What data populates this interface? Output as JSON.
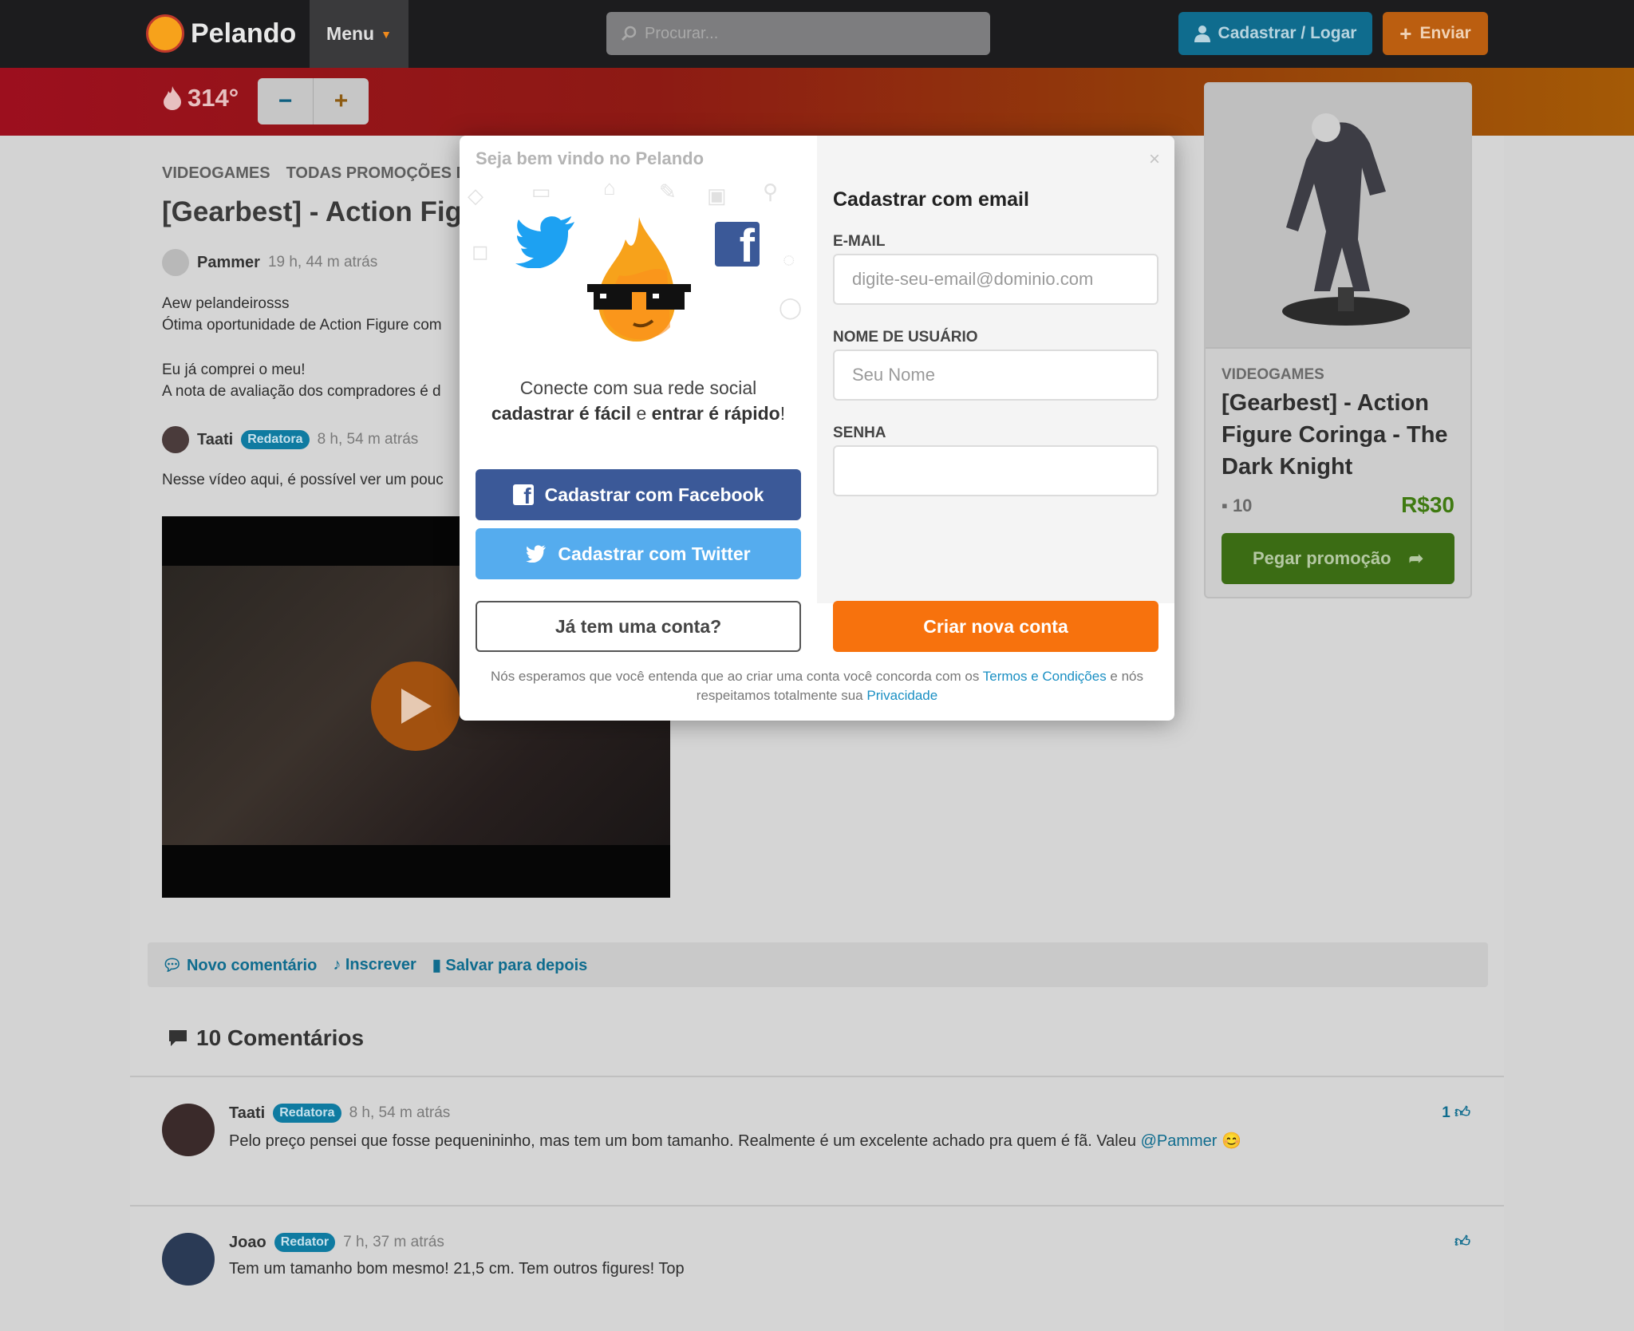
{
  "header": {
    "logo_text": "Pelando",
    "menu_label": "Menu",
    "search_placeholder": "Procurar...",
    "login_label": "Cadastrar / Logar",
    "send_label": "Enviar"
  },
  "heat": {
    "temperature": "314°",
    "minus": "−",
    "plus": "+"
  },
  "deal": {
    "crumbs": [
      "VIDEOGAMES",
      "TODAS PROMOÇÕES D"
    ],
    "title": "[Gearbest] - Action Figu",
    "author": "Pammer",
    "time": "19 h, 44 m atrás",
    "desc1": "Aew pelandeirosss",
    "desc2": "Ótima oportunidade de Action Figure com",
    "desc3": "Eu já comprei o meu!",
    "desc4": "A nota de avaliação dos compradores é d",
    "reviewer": "Taati",
    "reviewer_badge": "Redatora",
    "reviewer_time": "8 h, 54 m atrás",
    "review_text": "Nesse vídeo aqui, é possível ver um pouc"
  },
  "actions": {
    "new_comment": "Novo comentário",
    "subscribe": "Inscrever",
    "save": "Salvar para depois"
  },
  "comments": {
    "title": "10 Comentários",
    "items": [
      {
        "author": "Taati",
        "badge": "Redatora",
        "time": "8 h, 54 m atrás",
        "text": "Pelo preço pensei que fosse pequenininho, mas tem um bom tamanho. Realmente é um excelente achado pra quem é fã. Valeu ",
        "mention": "@Pammer",
        "likes": "1"
      },
      {
        "author": "Joao",
        "badge": "Redator",
        "time": "7 h, 37 m atrás",
        "text": "Tem um tamanho bom mesmo! 21,5 cm. Tem outros figures! Top",
        "likes": ""
      }
    ]
  },
  "sidebar": {
    "category": "VIDEOGAMES",
    "title": "[Gearbest] - Action Figure Coringa - The Dark Knight",
    "comments": "10",
    "price": "R$30",
    "button": "Pegar promoção"
  },
  "modal": {
    "welcome": "Seja bem vindo no Pelando",
    "close": "×",
    "connect_line1": "Conecte com sua rede social",
    "connect_b1": "cadastrar é fácil",
    "connect_mid": " e ",
    "connect_b2": "entrar é rápido",
    "connect_end": "!",
    "facebook_btn": "Cadastrar com Facebook",
    "twitter_btn": "Cadastrar com Twitter",
    "account_btn": "Já tem uma conta?",
    "form_title": "Cadastrar com email",
    "email_label": "E-MAIL",
    "email_placeholder": "digite-seu-email@dominio.com",
    "username_label": "NOME DE USUÁRIO",
    "username_placeholder": "Seu Nome",
    "password_label": "SENHA",
    "create_btn": "Criar nova conta",
    "terms_pre": "Nós esperamos que você entenda que ao criar uma conta você concorda com os ",
    "terms_link": "Termos e Condições",
    "terms_mid": " e nós respeitamos totalmente sua ",
    "privacy_link": "Privacidade"
  },
  "colors": {
    "accent_orange": "#f7720d",
    "facebook": "#3b5998",
    "twitter": "#55acee",
    "link_blue": "#1a8fc3"
  }
}
